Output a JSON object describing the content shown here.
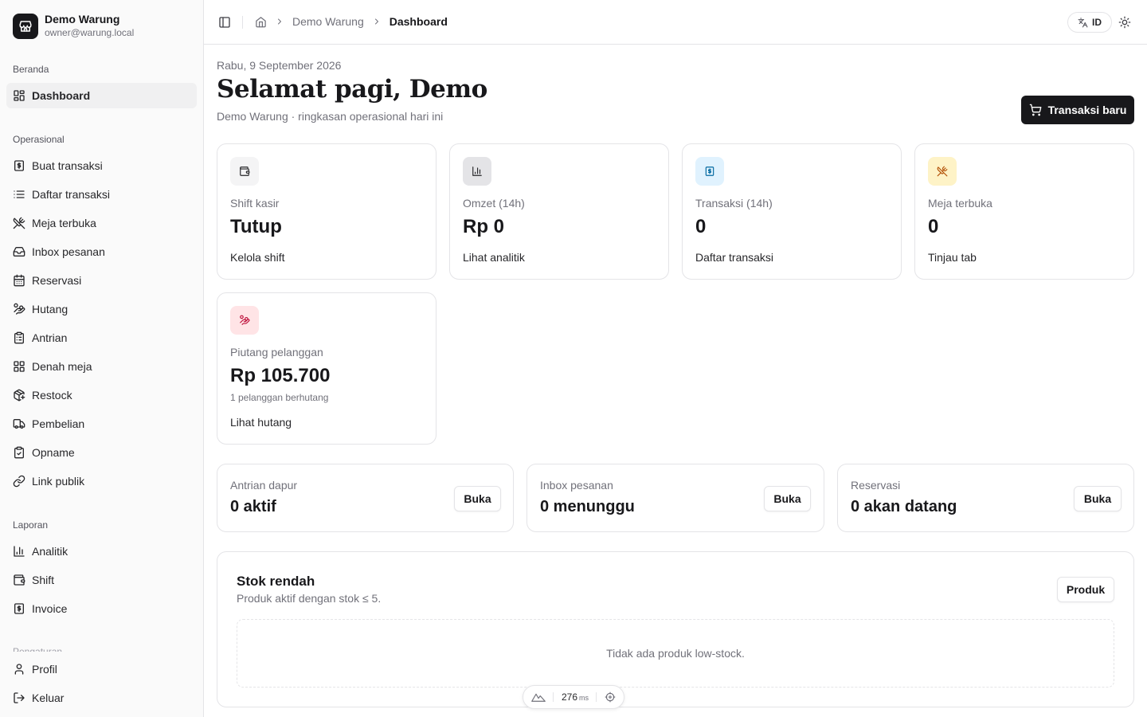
{
  "brand": {
    "name": "Demo Warung",
    "email": "owner@warung.local"
  },
  "sidebar": {
    "groups": [
      {
        "label": "Beranda"
      },
      {
        "label": "Operasional"
      },
      {
        "label": "Laporan"
      },
      {
        "label": "Pengaturan"
      }
    ],
    "items": [
      {
        "label": "Dashboard",
        "icon": "layout-dashboard-icon",
        "active": true
      },
      {
        "label": "Buat transaksi",
        "icon": "receipt-icon"
      },
      {
        "label": "Daftar transaksi",
        "icon": "list-icon"
      },
      {
        "label": "Meja terbuka",
        "icon": "utensils-crossed-icon"
      },
      {
        "label": "Inbox pesanan",
        "icon": "inbox-icon"
      },
      {
        "label": "Reservasi",
        "icon": "calendar-icon"
      },
      {
        "label": "Hutang",
        "icon": "hand-coins-icon"
      },
      {
        "label": "Antrian",
        "icon": "clipboard-list-icon"
      },
      {
        "label": "Denah meja",
        "icon": "layout-grid-icon"
      },
      {
        "label": "Restock",
        "icon": "package-plus-icon"
      },
      {
        "label": "Pembelian",
        "icon": "truck-icon"
      },
      {
        "label": "Opname",
        "icon": "clipboard-check-icon"
      },
      {
        "label": "Link publik",
        "icon": "link-icon"
      },
      {
        "label": "Analitik",
        "icon": "bar-chart-icon"
      },
      {
        "label": "Shift",
        "icon": "wallet-icon"
      },
      {
        "label": "Invoice",
        "icon": "receipt-icon"
      }
    ],
    "footer": [
      {
        "label": "Profil",
        "icon": "user-icon"
      },
      {
        "label": "Keluar",
        "icon": "log-out-icon"
      }
    ]
  },
  "header": {
    "breadcrumb": [
      "Demo Warung",
      "Dashboard"
    ],
    "lang": "ID"
  },
  "main": {
    "date": "Rabu, 9 September 2026",
    "greeting": "Selamat pagi, Demo",
    "subtitle": "Demo Warung · ringkasan operasional hari ini",
    "new_transaction": "Transaksi baru"
  },
  "stats": [
    {
      "label": "Shift kasir",
      "value": "Tutup",
      "link": "Kelola shift",
      "icon": "wallet-icon",
      "icon_bg": "#f4f4f5",
      "icon_color": "#27272a"
    },
    {
      "label": "Omzet (14h)",
      "value": "Rp 0",
      "link": "Lihat analitik",
      "icon": "bar-chart-icon",
      "icon_bg": "#e4e4e7",
      "icon_color": "#27272a"
    },
    {
      "label": "Transaksi (14h)",
      "value": "0",
      "link": "Daftar transaksi",
      "icon": "receipt-icon",
      "icon_bg": "#e0f2fe",
      "icon_color": "#0369a1"
    },
    {
      "label": "Meja terbuka",
      "value": "0",
      "link": "Tinjau tab",
      "icon": "utensils-crossed-icon",
      "icon_bg": "#fef3c7",
      "icon_color": "#b45309"
    },
    {
      "label": "Piutang pelanggan",
      "value": "Rp 105.700",
      "sub": "1 pelanggan berhutang",
      "link": "Lihat hutang",
      "icon": "hand-coins-icon",
      "icon_bg": "#ffe4e6",
      "icon_color": "#be123c"
    }
  ],
  "mini_cards": [
    {
      "label": "Antrian dapur",
      "value": "0 aktif",
      "button": "Buka"
    },
    {
      "label": "Inbox pesanan",
      "value": "0 menunggu",
      "button": "Buka"
    },
    {
      "label": "Reservasi",
      "value": "0 akan datang",
      "button": "Buka"
    }
  ],
  "low_stock": {
    "title": "Stok rendah",
    "description": "Produk aktif dengan stok ≤ 5.",
    "button": "Produk",
    "empty": "Tidak ada produk low-stock."
  },
  "perf": {
    "value": "276",
    "unit": "ms"
  }
}
